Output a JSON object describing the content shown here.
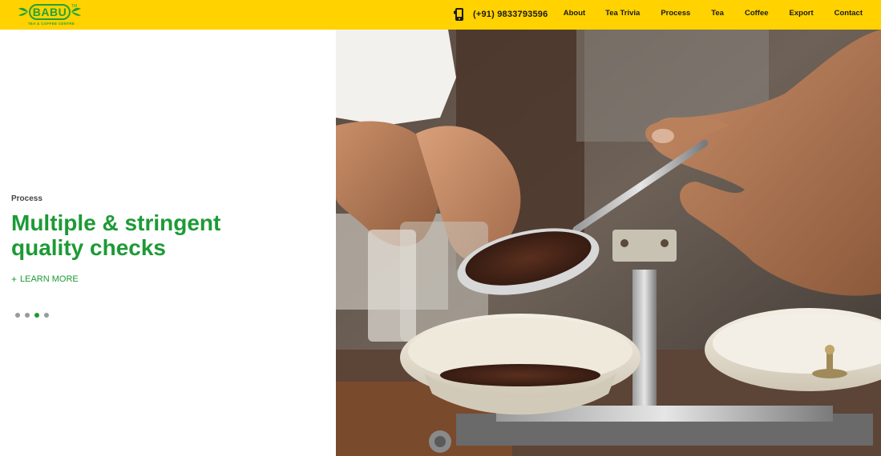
{
  "brand": {
    "name": "BABU",
    "tagline": "TEA & COFFEE CENTRE",
    "tm": "TM"
  },
  "header": {
    "phone": "(+91) 9833793596",
    "nav": [
      "About",
      "Tea Trivia",
      "Process",
      "Tea",
      "Coffee",
      "Export",
      "Contact"
    ]
  },
  "slide": {
    "eyebrow": "Process",
    "headline_line1": "Multiple & stringent",
    "headline_line2": "quality checks",
    "cta_plus": "+",
    "cta": "LEARN MORE",
    "total_slides": 4,
    "active_slide": 3
  },
  "colors": {
    "header_bg": "#ffd200",
    "brand_green": "#1d9a36",
    "dot_inactive": "#9a9a9a"
  },
  "icons": {
    "phone": "phone-icon",
    "logo_leaf": "leaf-icon"
  }
}
